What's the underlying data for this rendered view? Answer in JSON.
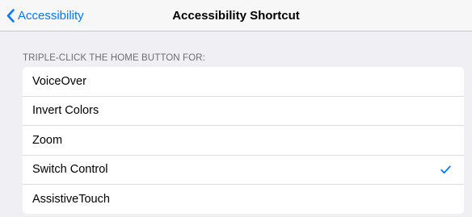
{
  "navbar": {
    "back_label": "Accessibility",
    "title": "Accessibility Shortcut"
  },
  "section": {
    "header": "TRIPLE-CLICK THE HOME BUTTON FOR:"
  },
  "options": [
    {
      "label": "VoiceOver",
      "selected": false
    },
    {
      "label": "Invert Colors",
      "selected": false
    },
    {
      "label": "Zoom",
      "selected": false
    },
    {
      "label": "Switch Control",
      "selected": true
    },
    {
      "label": "AssistiveTouch",
      "selected": false
    }
  ],
  "colors": {
    "accent": "#007aff",
    "background": "#efeff4",
    "header_text": "#6d6d72"
  },
  "icons": {
    "back": "chevron-left-icon",
    "selected": "checkmark-icon"
  }
}
